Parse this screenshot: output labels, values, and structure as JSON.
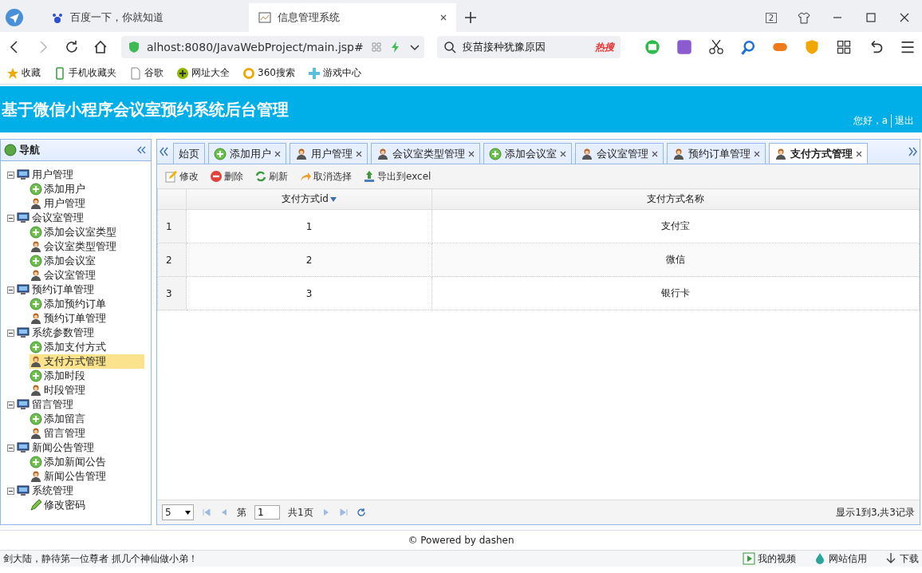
{
  "browser": {
    "tabs": [
      {
        "label": "百度一下，你就知道",
        "selected": false,
        "kind": "paw"
      },
      {
        "label": "信息管理系统",
        "selected": true,
        "kind": "page"
      }
    ],
    "tab_count": "2",
    "address": "alhost:8080/JavaWebProject/main.jsp#",
    "search": "疫苗接种犹豫原因",
    "hot": "热搜",
    "bookmarks": [
      {
        "label": "收藏",
        "kind": "star"
      },
      {
        "label": "手机收藏夹",
        "kind": "phone"
      },
      {
        "label": "谷歌",
        "kind": "doc"
      },
      {
        "label": "网址大全",
        "kind": "plus"
      },
      {
        "label": "360搜索",
        "kind": "ring"
      },
      {
        "label": "游戏中心",
        "kind": "cross"
      }
    ]
  },
  "header": {
    "title": "基于微信小程序会议室预约系统后台管理",
    "greeting": "您好，a",
    "logout": "退出"
  },
  "sidebar": {
    "title": "导航",
    "tree": [
      {
        "label": "用户管理",
        "selected": false,
        "children": [
          {
            "label": "添加用户",
            "kind": "add",
            "selected": false
          },
          {
            "label": "用户管理",
            "kind": "user",
            "selected": false
          }
        ]
      },
      {
        "label": "会议室管理",
        "selected": false,
        "children": [
          {
            "label": "添加会议室类型",
            "kind": "add",
            "selected": false
          },
          {
            "label": "会议室类型管理",
            "kind": "user",
            "selected": false
          },
          {
            "label": "添加会议室",
            "kind": "add",
            "selected": false
          },
          {
            "label": "会议室管理",
            "kind": "user",
            "selected": false
          }
        ]
      },
      {
        "label": "预约订单管理",
        "selected": false,
        "children": [
          {
            "label": "添加预约订单",
            "kind": "add",
            "selected": false
          },
          {
            "label": "预约订单管理",
            "kind": "user",
            "selected": false
          }
        ]
      },
      {
        "label": "系统参数管理",
        "selected": false,
        "children": [
          {
            "label": "添加支付方式",
            "kind": "add",
            "selected": false
          },
          {
            "label": "支付方式管理",
            "kind": "user",
            "selected": true
          },
          {
            "label": "添加时段",
            "kind": "add",
            "selected": false
          },
          {
            "label": "时段管理",
            "kind": "user",
            "selected": false
          }
        ]
      },
      {
        "label": "留言管理",
        "selected": false,
        "children": [
          {
            "label": "添加留言",
            "kind": "add",
            "selected": false
          },
          {
            "label": "留言管理",
            "kind": "user",
            "selected": false
          }
        ]
      },
      {
        "label": "新闻公告管理",
        "selected": false,
        "children": [
          {
            "label": "添加新闻公告",
            "kind": "add",
            "selected": false
          },
          {
            "label": "新闻公告管理",
            "kind": "user",
            "selected": false
          }
        ]
      },
      {
        "label": "系统管理",
        "selected": false,
        "children": [
          {
            "label": "修改密码",
            "kind": "pencil",
            "selected": false
          }
        ]
      }
    ]
  },
  "tabs": [
    {
      "label": "始页",
      "kind": "home",
      "selected": false
    },
    {
      "label": "添加用户",
      "kind": "add",
      "selected": false
    },
    {
      "label": "用户管理",
      "kind": "user",
      "selected": false
    },
    {
      "label": "会议室类型管理",
      "kind": "user",
      "selected": false
    },
    {
      "label": "添加会议室",
      "kind": "add",
      "selected": false
    },
    {
      "label": "会议室管理",
      "kind": "user",
      "selected": false
    },
    {
      "label": "预约订单管理",
      "kind": "user",
      "selected": false
    },
    {
      "label": "支付方式管理",
      "kind": "user",
      "selected": true
    }
  ],
  "toolbar": [
    {
      "label": "修改",
      "kind": "edit"
    },
    {
      "label": "删除",
      "kind": "delete"
    },
    {
      "label": "刷新",
      "kind": "refresh"
    },
    {
      "label": "取消选择",
      "kind": "undo"
    },
    {
      "label": "导出到excel",
      "kind": "export"
    }
  ],
  "table": {
    "columns": [
      "支付方式id",
      "支付方式名称"
    ],
    "rows": [
      {
        "number": "1",
        "cells": [
          "1",
          "支付宝"
        ]
      },
      {
        "number": "2",
        "cells": [
          "2",
          "微信"
        ]
      },
      {
        "number": "3",
        "cells": [
          "3",
          "银行卡"
        ]
      }
    ]
  },
  "pager": {
    "page_size": "5",
    "page_prefix": "第",
    "page": "1",
    "page_total": "共1页",
    "summary": "显示1到3,共3记录"
  },
  "footer": "© Powered by dashen",
  "status_bar": {
    "text": "剑大陆，静待第一位尊者 抓几个神仙做小弟！",
    "items": [
      {
        "label": "我的视频",
        "kind": "play"
      },
      {
        "label": "网站信用",
        "kind": "drop"
      },
      {
        "label": "下载",
        "kind": "download"
      }
    ]
  }
}
